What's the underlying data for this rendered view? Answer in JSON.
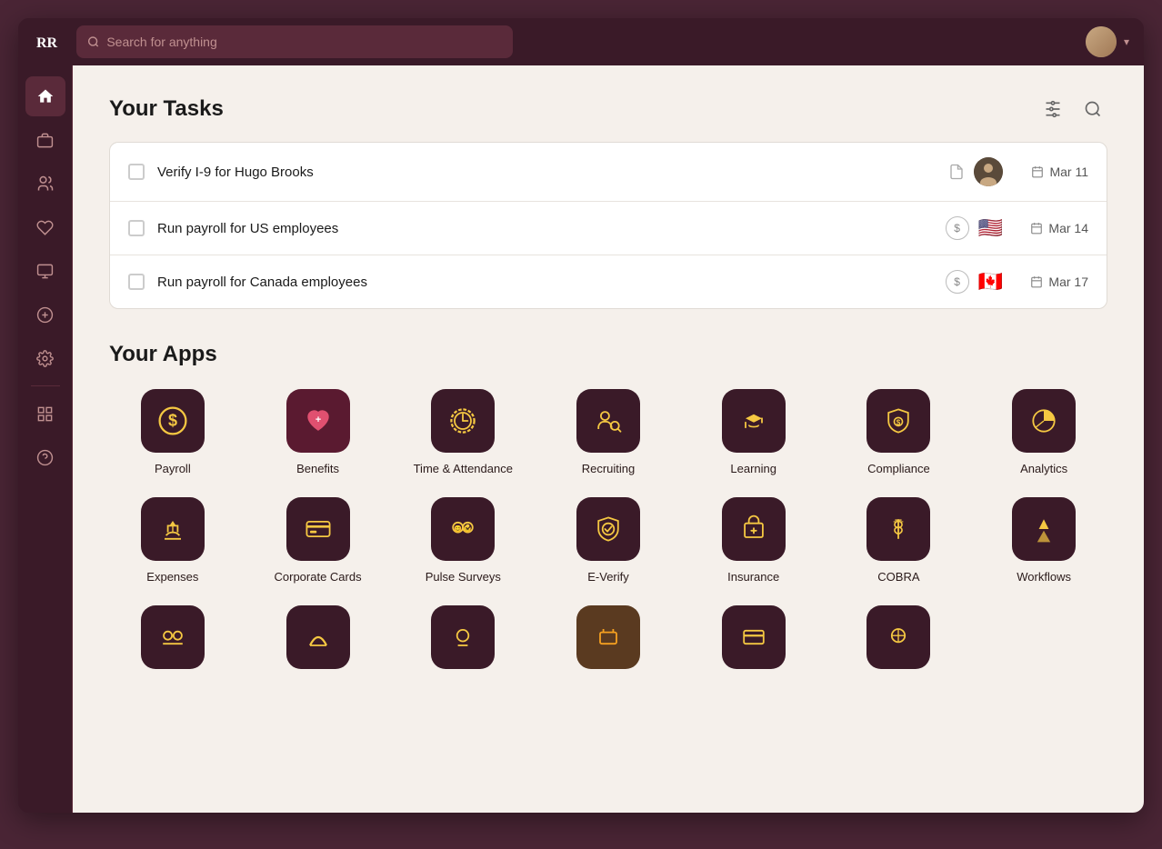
{
  "topbar": {
    "logo": "RR",
    "search_placeholder": "Search for anything",
    "chevron": "▾"
  },
  "sidebar": {
    "items": [
      {
        "id": "home",
        "icon": "🏠",
        "active": true
      },
      {
        "id": "briefcase",
        "icon": "💼",
        "active": false
      },
      {
        "id": "people",
        "icon": "👥",
        "active": false
      },
      {
        "id": "heart",
        "icon": "♡",
        "active": false
      },
      {
        "id": "monitor",
        "icon": "🖥",
        "active": false
      },
      {
        "id": "dollar",
        "icon": "＄",
        "active": false
      },
      {
        "id": "settings",
        "icon": "⚙",
        "active": false
      },
      {
        "id": "widgets",
        "icon": "⊞",
        "active": false
      },
      {
        "id": "help",
        "icon": "？",
        "active": false
      }
    ]
  },
  "tasks": {
    "title": "Your Tasks",
    "items": [
      {
        "id": "task1",
        "label": "Verify I-9 for Hugo Brooks",
        "has_doc": true,
        "has_avatar": true,
        "flag": null,
        "date": "Mar 11"
      },
      {
        "id": "task2",
        "label": "Run payroll for US employees",
        "has_doc": false,
        "has_avatar": false,
        "flag": "🇺🇸",
        "date": "Mar 14"
      },
      {
        "id": "task3",
        "label": "Run payroll for Canada employees",
        "has_doc": false,
        "has_avatar": false,
        "flag": "🇨🇦",
        "date": "Mar 17"
      }
    ]
  },
  "apps": {
    "title": "Your Apps",
    "rows": [
      [
        {
          "id": "payroll",
          "label": "Payroll",
          "icon_type": "dollar-circle"
        },
        {
          "id": "benefits",
          "label": "Benefits",
          "icon_type": "heart-plus"
        },
        {
          "id": "time-attendance",
          "label": "Time & Attendance",
          "icon_type": "clock-circle"
        },
        {
          "id": "recruiting",
          "label": "Recruiting",
          "icon_type": "people-search"
        },
        {
          "id": "learning",
          "label": "Learning",
          "icon_type": "graduation"
        },
        {
          "id": "compliance",
          "label": "Compliance",
          "icon_type": "shield-dollar"
        },
        {
          "id": "analytics",
          "label": "Analytics",
          "icon_type": "pie-chart"
        }
      ],
      [
        {
          "id": "expenses",
          "label": "Expenses",
          "icon_type": "hand-dollar"
        },
        {
          "id": "corporate-cards",
          "label": "Corporate Cards",
          "icon_type": "credit-card"
        },
        {
          "id": "pulse-surveys",
          "label": "Pulse Surveys",
          "icon_type": "emoji-survey"
        },
        {
          "id": "e-verify",
          "label": "E-Verify",
          "icon_type": "badge-check"
        },
        {
          "id": "insurance",
          "label": "Insurance",
          "icon_type": "briefcase-plus"
        },
        {
          "id": "cobra",
          "label": "COBRA",
          "icon_type": "caduceus"
        },
        {
          "id": "workflows",
          "label": "Workflows",
          "icon_type": "lightning"
        }
      ],
      [
        {
          "id": "app-partial-1",
          "label": "",
          "icon_type": "partial1"
        },
        {
          "id": "app-partial-2",
          "label": "",
          "icon_type": "partial2"
        },
        {
          "id": "app-partial-3",
          "label": "",
          "icon_type": "partial3"
        },
        {
          "id": "app-partial-4",
          "label": "",
          "icon_type": "partial4"
        },
        {
          "id": "app-partial-5",
          "label": "",
          "icon_type": "partial5"
        },
        {
          "id": "app-partial-6",
          "label": "",
          "icon_type": "partial6"
        }
      ]
    ]
  },
  "colors": {
    "icon_bg": "#3a1a28",
    "icon_yellow": "#f5c842",
    "icon_orange": "#f0a030",
    "icon_pink": "#e05070"
  }
}
